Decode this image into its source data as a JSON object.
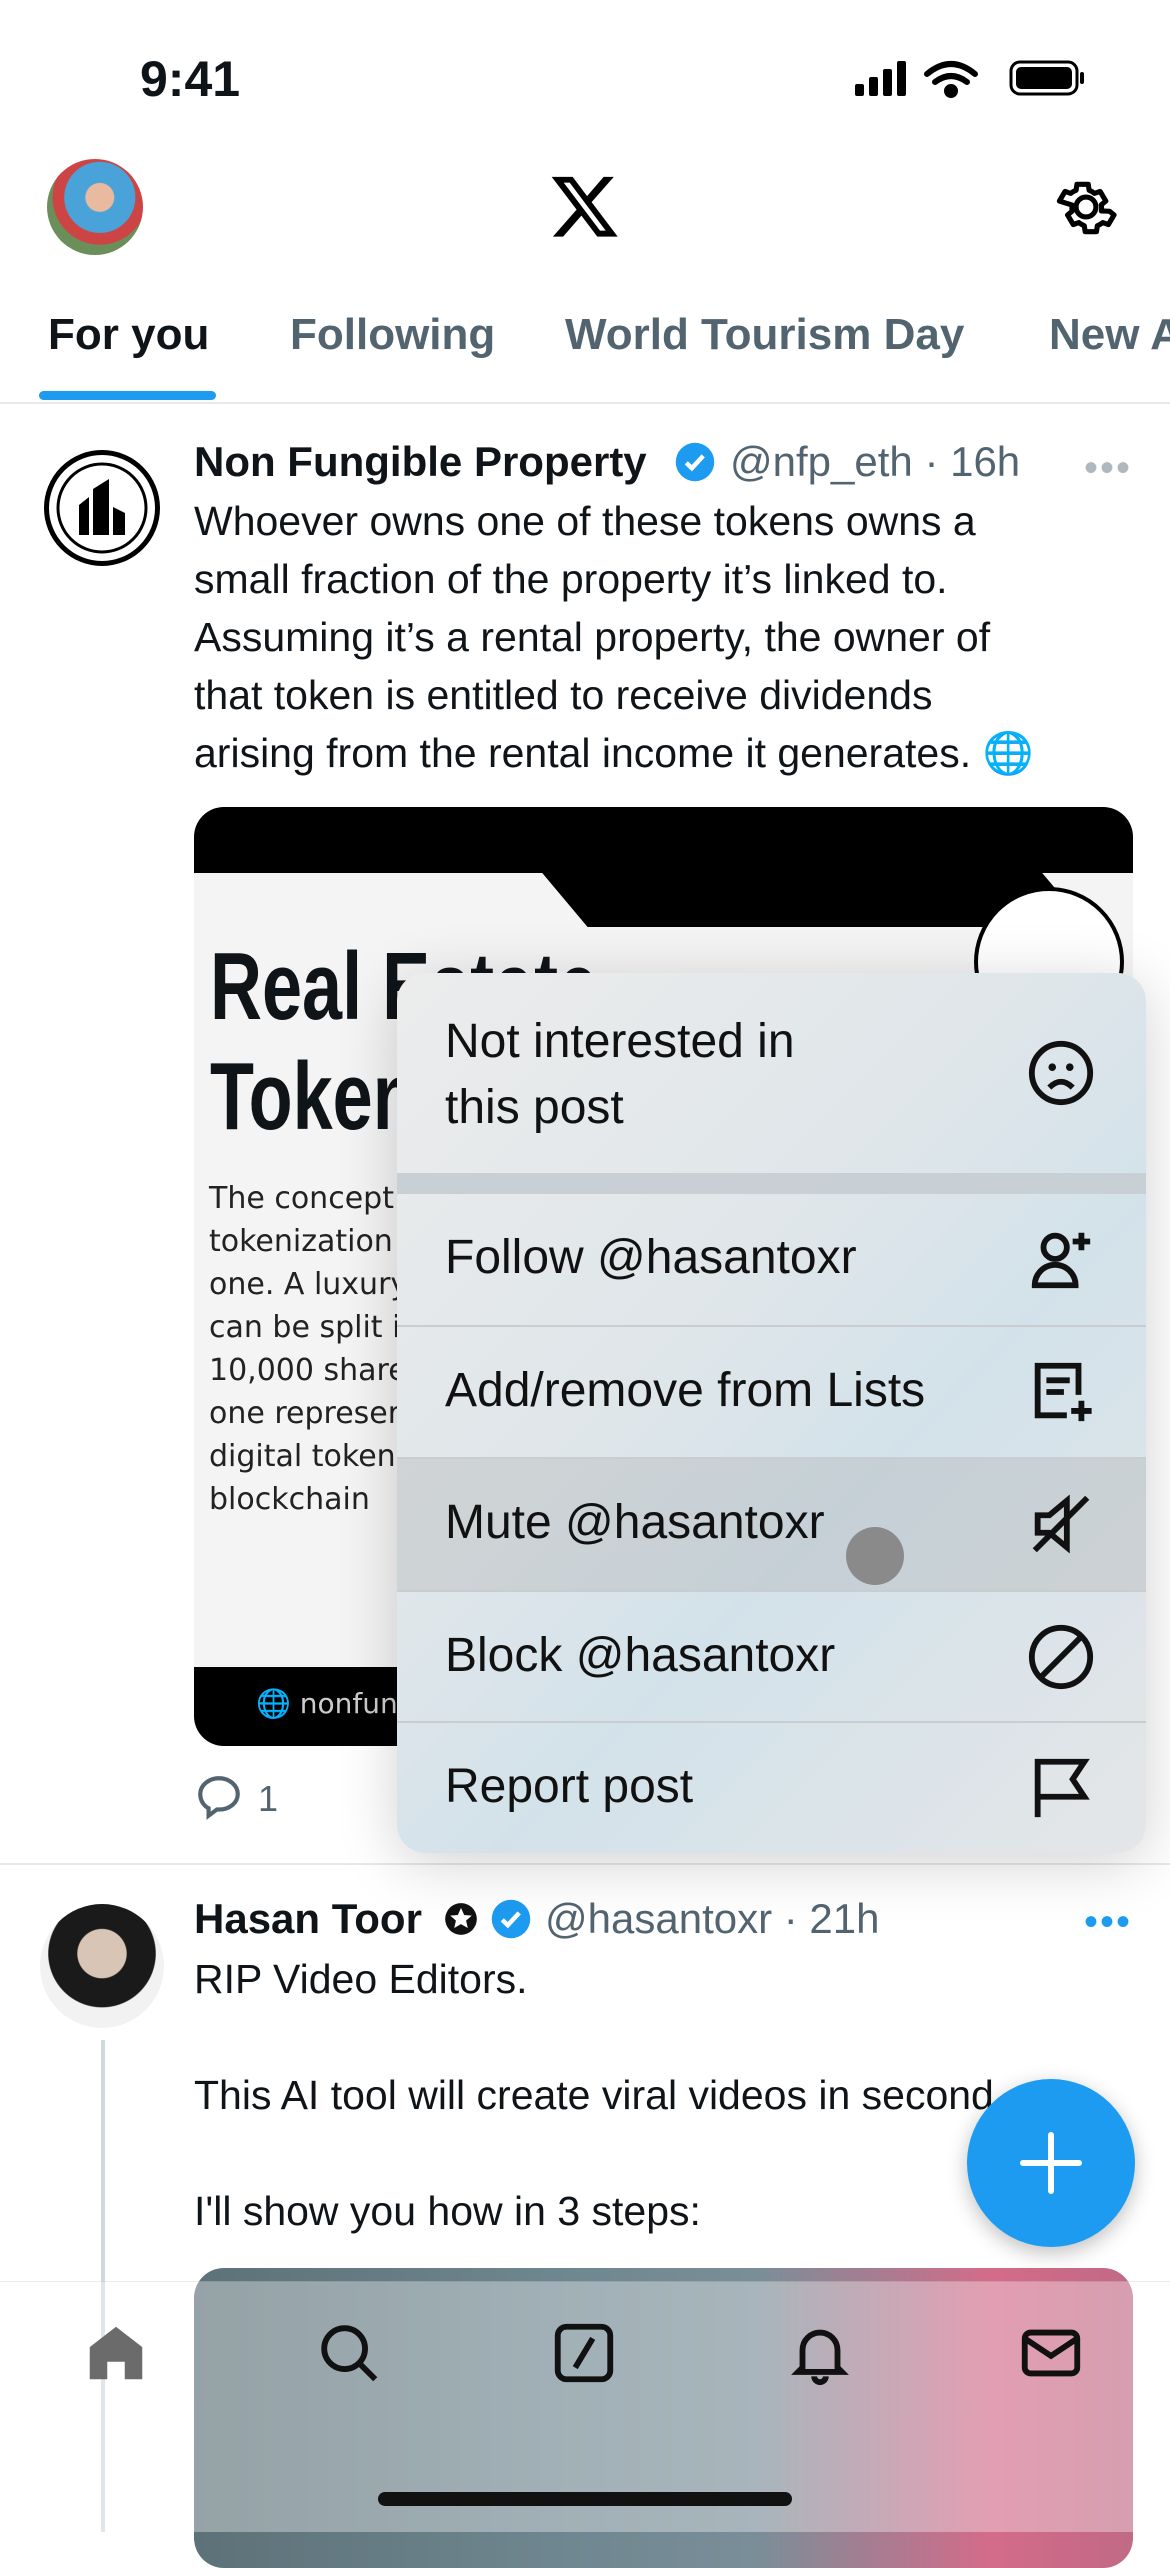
{
  "status_bar": {
    "time": "9:41"
  },
  "header": {
    "logo": "X",
    "settings_icon": "gear-icon"
  },
  "tabs": [
    {
      "label": "For you",
      "active": true
    },
    {
      "label": "Following"
    },
    {
      "label": "World Tourism Day"
    },
    {
      "label": "New A"
    }
  ],
  "posts": [
    {
      "name": "Non Fungible Property",
      "handle": "@nfp_eth",
      "time": "· 16h",
      "verified": true,
      "body": [
        "Whoever owns one of these tokens owns a",
        "small fraction of the property it’s linked to.",
        "Assuming it’s a rental property, the owner of",
        "that token is entitled to receive dividends",
        "arising from the rental income it generates. 🌐"
      ],
      "card": {
        "title1": "Real Estate",
        "title2": "Token",
        "text": [
          "The concept",
          "tokenization",
          "one. A luxury",
          "can be split i",
          "10,000 share",
          "one represer",
          "digital token",
          "blockchain"
        ],
        "footer": "nonfungi"
      },
      "replies": "1"
    },
    {
      "name": "Hasan Toor",
      "handle": "@hasantoxr",
      "time": "· 21h",
      "verified": true,
      "body": [
        "RIP Video Editors.",
        "This AI tool will create viral videos in seconds.",
        "I'll show you how in 3 steps:"
      ]
    }
  ],
  "menu": {
    "items": [
      {
        "label1": "Not interested in",
        "label2": "this post",
        "icon": "sad-face-icon"
      },
      {
        "label": "Follow @hasantoxr",
        "icon": "follow-user-icon"
      },
      {
        "label": "Add/remove from Lists",
        "icon": "list-add-icon"
      },
      {
        "label": "Mute @hasantoxr",
        "icon": "mute-icon",
        "highlighted": true
      },
      {
        "label": "Block @hasantoxr",
        "icon": "block-icon"
      },
      {
        "label": "Report post",
        "icon": "flag-icon"
      }
    ]
  },
  "fab": {
    "icon": "plus-icon"
  },
  "tabbar": [
    "home-icon",
    "search-icon",
    "grok-icon",
    "bell-icon",
    "mail-icon"
  ],
  "colors": {
    "accent": "#1d9bf0",
    "text": "#0f1419",
    "muted": "#536471"
  }
}
